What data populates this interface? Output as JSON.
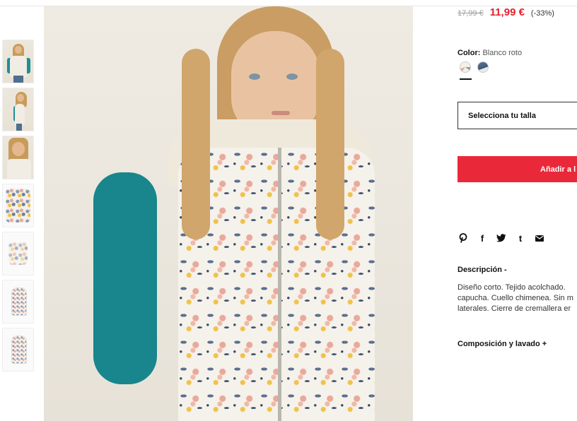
{
  "product": {
    "price_old": "17,99 €",
    "price_new": "11,99 €",
    "discount": "(-33%)"
  },
  "color": {
    "label": "Color:",
    "value": "Blanco roto",
    "swatches": [
      "Blanco roto",
      "Azul"
    ],
    "selected_index": 0
  },
  "size": {
    "placeholder": "Selecciona tu talla"
  },
  "cart": {
    "button_label": "Añadir a l"
  },
  "share": {
    "icons": [
      "pinterest-icon",
      "facebook-icon",
      "twitter-icon",
      "tumblr-icon",
      "email-icon"
    ],
    "glyphs": [
      "℗",
      "f",
      "🐦",
      "t",
      "✉"
    ]
  },
  "description": {
    "title": "Descripción -",
    "lines": [
      "Diseño corto. Tejido acolchado.",
      "capucha. Cuello chimenea. Sin m",
      "laterales. Cierre de cremallera er"
    ]
  },
  "composition": {
    "title": "Composición y lavado +"
  },
  "thumbnails": [
    "model-front",
    "model-side",
    "model-closeup",
    "fabric-detail",
    "label-detail",
    "garment-front",
    "garment-back"
  ],
  "colors": {
    "accent": "#e9293a",
    "price_sale": "#e5202e"
  }
}
